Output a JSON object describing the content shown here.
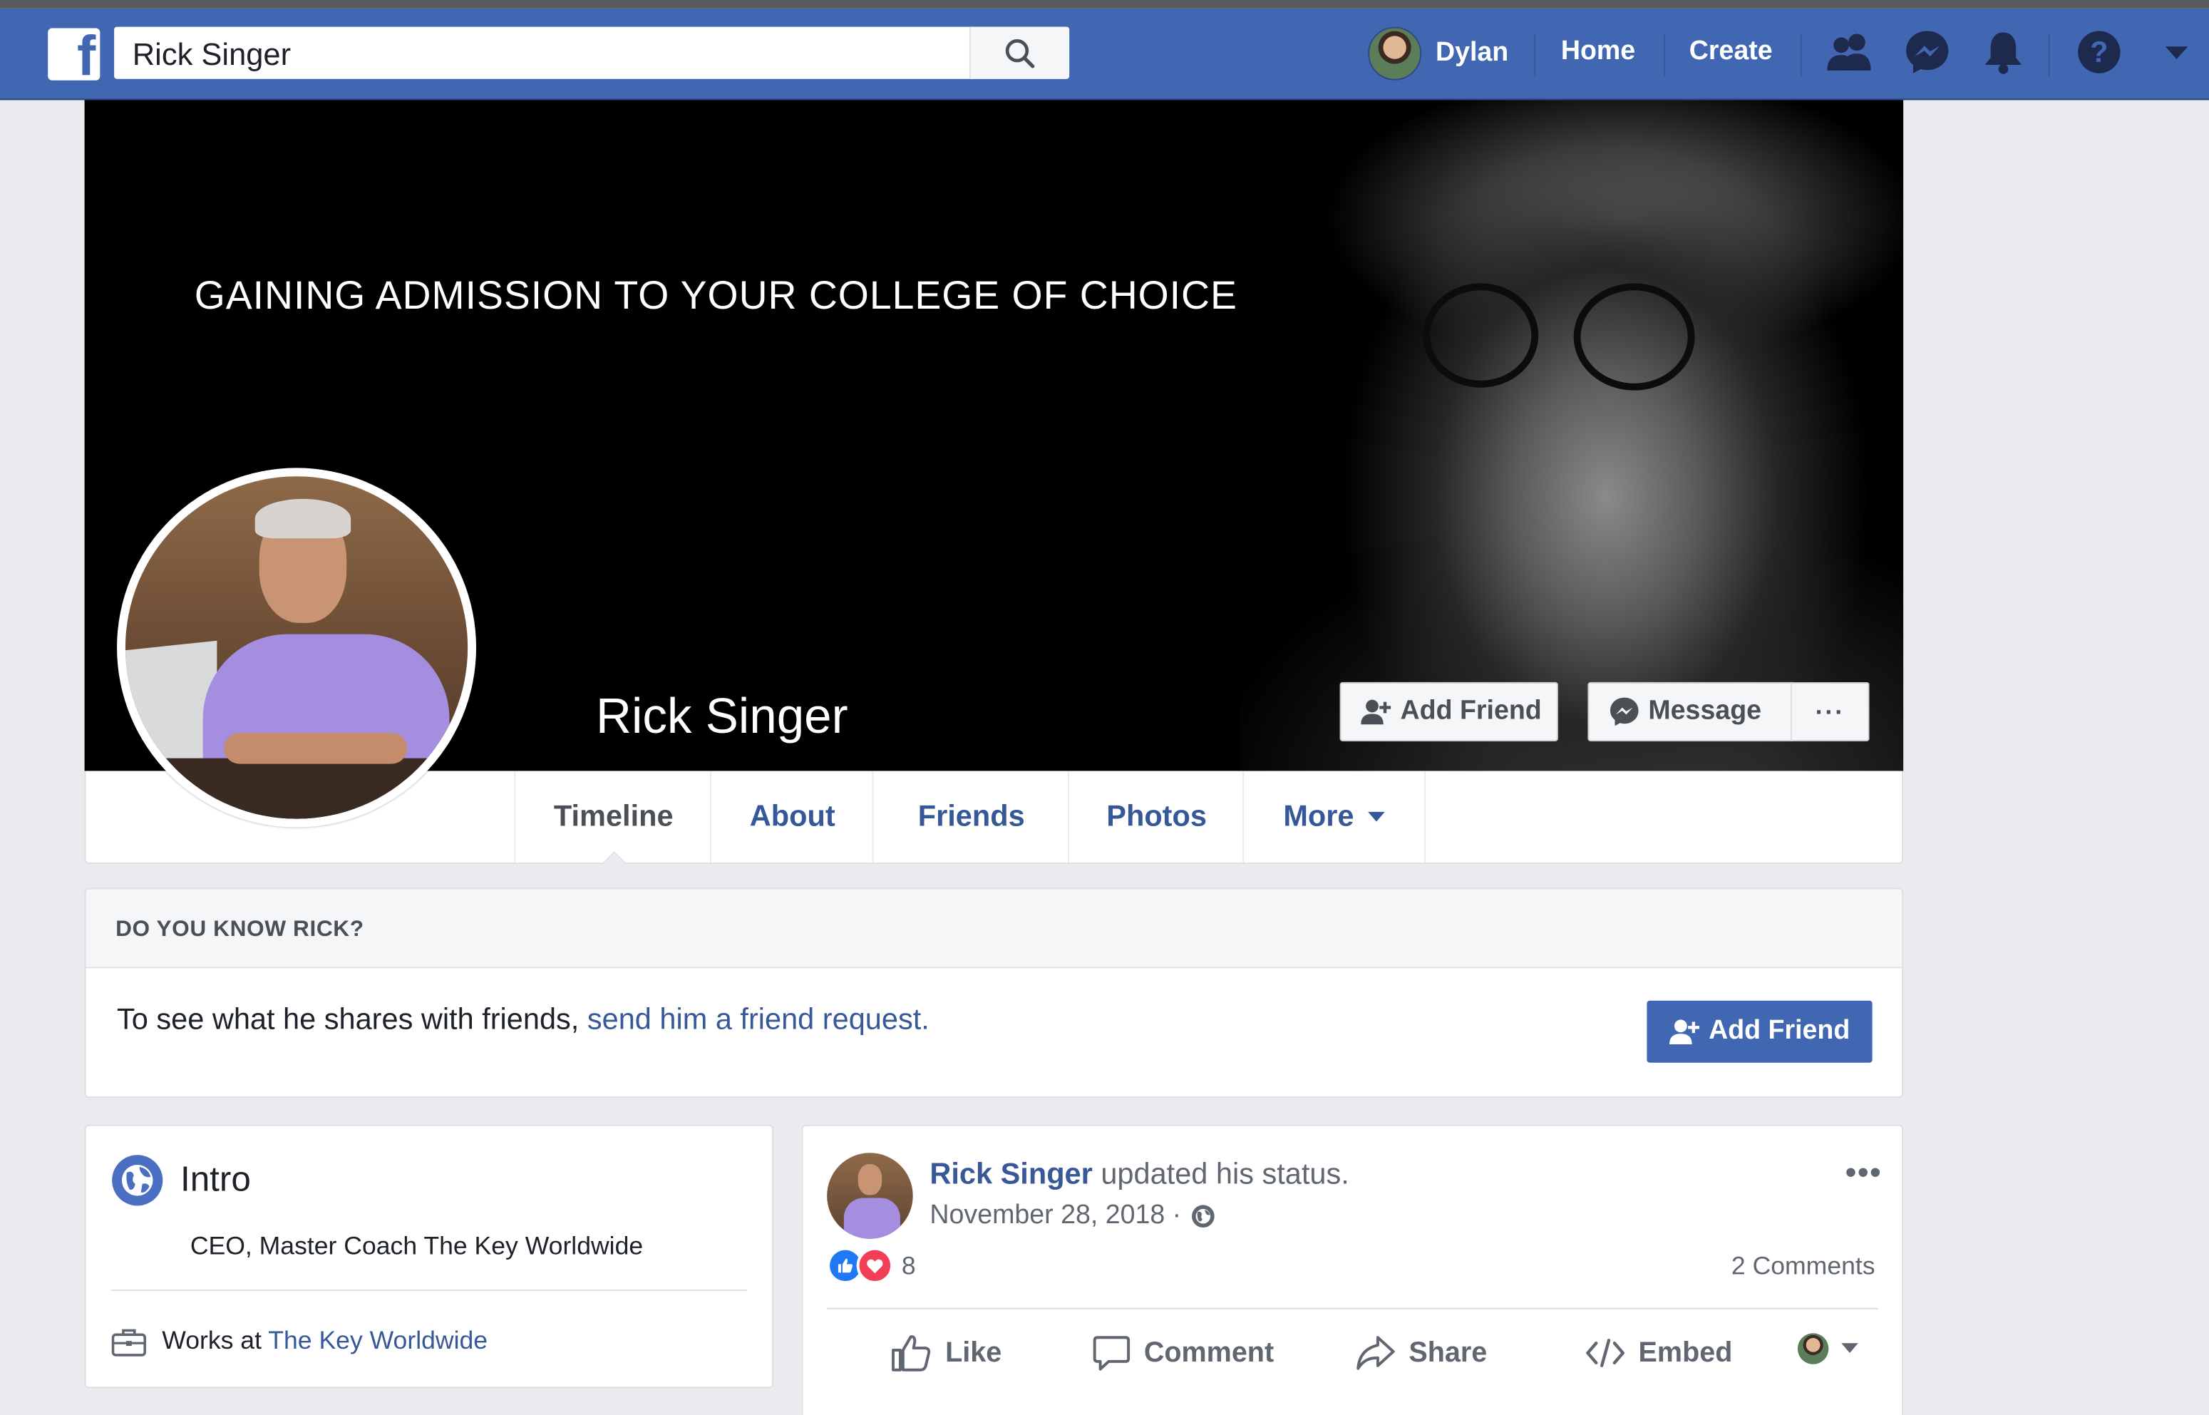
{
  "topbar": {
    "search_value": "Rick Singer",
    "user_name": "Dylan",
    "home_label": "Home",
    "create_label": "Create",
    "icons": [
      "facebook-logo-icon",
      "search-icon",
      "friend-requests-icon",
      "messenger-icon",
      "notifications-icon",
      "help-icon",
      "account-menu-icon"
    ],
    "brand_color": "#4267b2"
  },
  "cover": {
    "tagline": "GAINING ADMISSION TO YOUR COLLEGE OF CHOICE",
    "profile_name": "Rick Singer",
    "add_friend_label": "Add Friend",
    "message_label": "Message",
    "more_label": "···"
  },
  "tabs": [
    {
      "label": "Timeline",
      "active": true
    },
    {
      "label": "About"
    },
    {
      "label": "Friends"
    },
    {
      "label": "Photos"
    },
    {
      "label": "More"
    }
  ],
  "know_card": {
    "title": "DO YOU KNOW RICK?",
    "text": "To see what he shares with friends,",
    "link": "send him a friend request.",
    "button": "Add Friend"
  },
  "intro": {
    "title": "Intro",
    "bio": "CEO, Master Coach The Key Worldwide",
    "works_prefix": "Works at",
    "works_link": "The Key Worldwide"
  },
  "post": {
    "author": "Rick Singer",
    "action": "updated his status.",
    "date": "November 28, 2018 ·",
    "reaction_count": "8",
    "comments": "2 Comments",
    "more": "•••",
    "actions": {
      "like": "Like",
      "comment": "Comment",
      "share": "Share",
      "embed": "Embed"
    }
  }
}
